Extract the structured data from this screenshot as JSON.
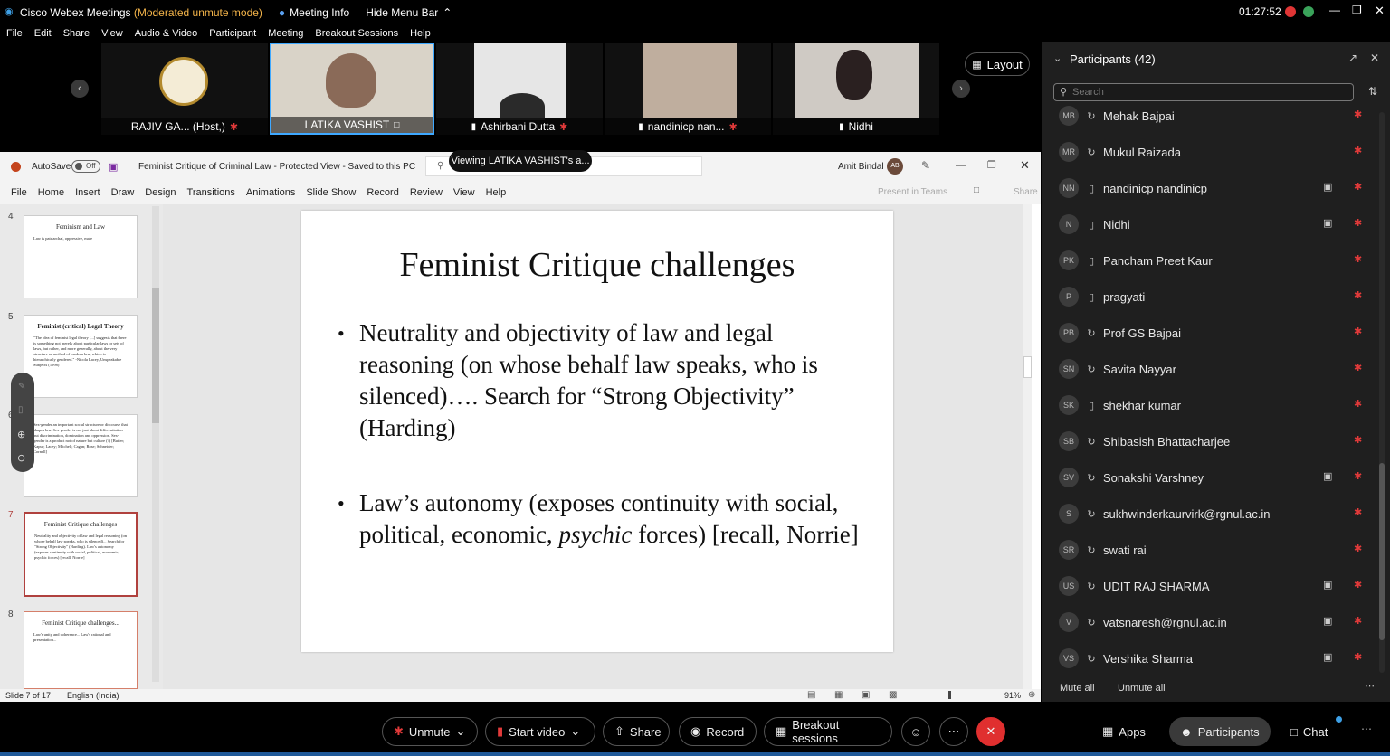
{
  "titlebar": {
    "app": "Cisco Webex Meetings",
    "mode": "(Moderated unmute mode)",
    "meeting_info": "Meeting Info",
    "hide_menu": "Hide Menu Bar",
    "time": "01:27:52"
  },
  "menu": [
    "File",
    "Edit",
    "Share",
    "View",
    "Audio & Video",
    "Participant",
    "Meeting",
    "Breakout Sessions",
    "Help"
  ],
  "videos": [
    {
      "name": "RAJIV GA... (Host,)"
    },
    {
      "name": "LATIKA VASHIST"
    },
    {
      "name": "Ashirbani Dutta"
    },
    {
      "name": "nandinicp nan..."
    },
    {
      "name": "Nidhi"
    }
  ],
  "layout_label": "Layout",
  "viewing_banner": "Viewing LATIKA VASHIST's a...",
  "ppt": {
    "autosave": "AutoSave",
    "autosave_state": "Off",
    "doc_title": "Feminist Critique of Criminal Law  -  Protected View  -  Saved to this PC",
    "user": "Amit Bindal",
    "user_initials": "AB",
    "tabs": [
      "File",
      "Home",
      "Insert",
      "Draw",
      "Design",
      "Transitions",
      "Animations",
      "Slide Show",
      "Record",
      "Review",
      "View",
      "Help"
    ],
    "present_teams": "Present in Teams",
    "share": "Share",
    "thumbs": [
      {
        "num": "4",
        "title": "Feminism and Law",
        "body": "Law is patriarchal, oppressive, male"
      },
      {
        "num": "5",
        "title": "Feminist (critical) Legal Theory",
        "body": "\"The idea of feminist legal theory [...] suggests that there is something not merely about particular laws or sets of laws, but rather, and more generally, about the very structure or method of modern law, which is hierarchically gendered.\" -Nicola Lacey, Unspeakable Subjects (1998)"
      },
      {
        "num": "6",
        "title": "",
        "body": "Sex-gender an important social structure or discourse that shapes law. Sex-gender is not just about differentiation but discrimination, domination and oppression. Sex-gender is a product not of nature but culture (?) [Butler; Kapur; Lacey; Mitchell; Cagan; Rose; Schneider; Cornell]"
      },
      {
        "num": "7",
        "title": "Feminist Critique challenges",
        "body": "Neutrality and objectivity of law and legal reasoning (on whose behalf law speaks, who is silenced)... Search for \"Strong Objectivity\" (Harding). Law's autonomy (exposes continuity with social, political, economic, psychic forces) [recall, Norrie]"
      },
      {
        "num": "8",
        "title": "Feminist Critique challenges...",
        "body": "Law's unity and coherence... Law's rational and presentation..."
      }
    ],
    "slide": {
      "title": "Feminist Critique challenges",
      "b1": "Neutrality and objectivity of law and legal reasoning (on whose behalf law speaks, who is silenced)…. Search for “Strong Objectivity” (Harding)",
      "b2_pre": "Law’s autonomy (exposes continuity with social, political, economic, ",
      "b2_em": "psychic",
      "b2_post": " forces) [recall, Norrie]"
    },
    "status": {
      "slide": "Slide 7 of 17",
      "lang": "English (India)",
      "zoom": "91%"
    }
  },
  "panel": {
    "title": "Participants (42)",
    "search_placeholder": "Search",
    "mute_all": "Mute all",
    "unmute_all": "Unmute all",
    "participants": [
      {
        "i": "MB",
        "n": "Mehak Bajpai",
        "d": "sync",
        "v": false
      },
      {
        "i": "MR",
        "n": "Mukul Raizada",
        "d": "sync",
        "v": false
      },
      {
        "i": "NN",
        "n": "nandinicp nandinicp",
        "d": "phone",
        "v": true
      },
      {
        "i": "N",
        "n": "Nidhi",
        "d": "phone",
        "v": true
      },
      {
        "i": "PK",
        "n": "Pancham Preet Kaur",
        "d": "phone",
        "v": false
      },
      {
        "i": "P",
        "n": "pragyati",
        "d": "phone",
        "v": false
      },
      {
        "i": "PB",
        "n": "Prof GS Bajpai",
        "d": "sync",
        "v": false
      },
      {
        "i": "SN",
        "n": "Savita Nayyar",
        "d": "sync",
        "v": false
      },
      {
        "i": "SK",
        "n": "shekhar kumar",
        "d": "phone",
        "v": false
      },
      {
        "i": "SB",
        "n": "Shibasish Bhattacharjee",
        "d": "sync",
        "v": false
      },
      {
        "i": "SV",
        "n": "Sonakshi Varshney",
        "d": "sync",
        "v": true
      },
      {
        "i": "S",
        "n": "sukhwinderkaurvirk@rgnul.ac.in",
        "d": "sync",
        "v": false
      },
      {
        "i": "SR",
        "n": "swati rai",
        "d": "sync",
        "v": false
      },
      {
        "i": "US",
        "n": "UDIT RAJ SHARMA",
        "d": "sync",
        "v": true
      },
      {
        "i": "V",
        "n": "vatsnaresh@rgnul.ac.in",
        "d": "sync",
        "v": true
      },
      {
        "i": "VS",
        "n": "Vershika Sharma",
        "d": "sync",
        "v": true
      }
    ]
  },
  "toolbar": {
    "unmute": "Unmute",
    "start_video": "Start video",
    "share": "Share",
    "record": "Record",
    "breakout": "Breakout sessions",
    "apps": "Apps",
    "participants": "Participants",
    "chat": "Chat"
  }
}
